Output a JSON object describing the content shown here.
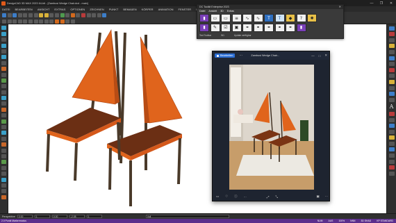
{
  "app": {
    "title": "DesignCAD 3D MAX 2023 64-bit - [Zambusi Wedge Chair.dcd - main]",
    "window_controls": [
      "—",
      "❐",
      "✕"
    ]
  },
  "menu": [
    "DATEI",
    "BEARBEITEN",
    "ANSICHT",
    "EXTRAS",
    "OPTIONEN",
    "ZEICHNEN",
    "PUNKT",
    "BEMAßEN",
    "KÖRPER",
    "ANIMATION",
    "FENSTER",
    "HILFE"
  ],
  "toolbox": {
    "title": "DC Toolkit Enterprise 2023",
    "close": "✕",
    "menu": [
      "Datei",
      "Ansicht",
      "3D",
      "Extras"
    ],
    "footer": [
      "Text Toolbar",
      "W1",
      "Update verfügbar"
    ]
  },
  "viewer": {
    "edit_label": "Bearbeiten",
    "more": "···",
    "title": "Zambusi Wedge Chair...",
    "controls": [
      "—",
      "□",
      "✕"
    ],
    "footer_left": [
      "▭",
      "♡",
      "ⓘ",
      "···"
    ],
    "footer_right": [
      "⤢",
      "⤡"
    ],
    "footer_far_right": [
      "▣",
      "···"
    ]
  },
  "bottombar": {
    "view_label": "Perspektive",
    "fields": [
      "0.00",
      "1",
      "0.00",
      "-2.08",
      "1"
    ],
    "mode_label": "Voll"
  },
  "status": {
    "left": "2.0 Punkt Markermodus",
    "right": [
      "NUM",
      "AUS",
      "100%",
      "NNN",
      "3D SHAD",
      "KP STANDARD"
    ]
  },
  "colors": {
    "status_bar": "#5b2e8c",
    "chair_seat": "#6b2f14",
    "chair_back": "#e0641c",
    "chair_legs": "#4a3a2a"
  }
}
